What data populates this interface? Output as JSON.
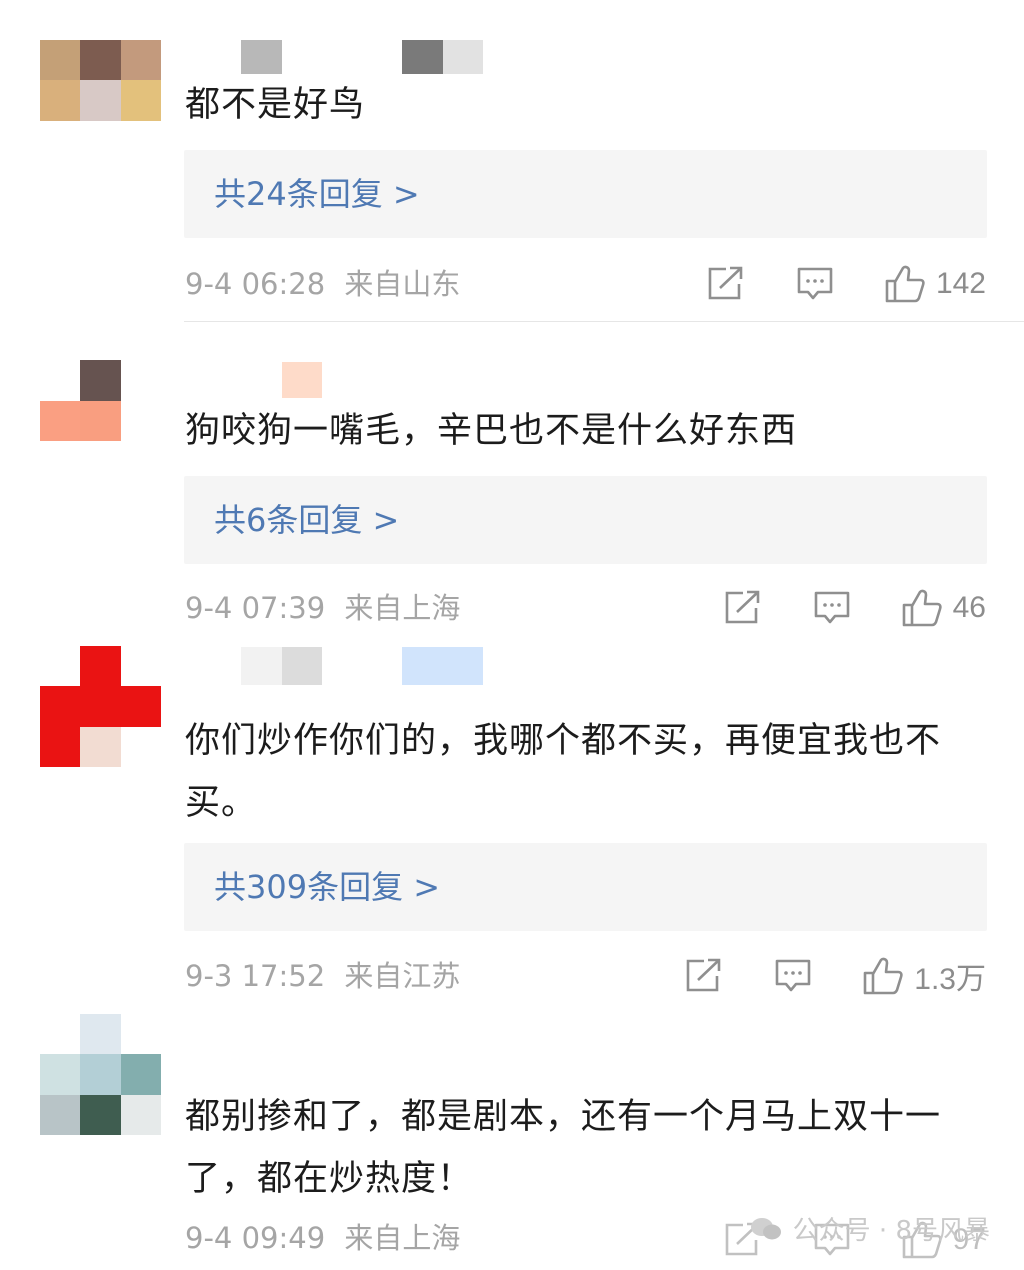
{
  "comments": [
    {
      "text": "都不是好鸟",
      "reply_label": "共24条回复 >",
      "date": "9-4 06:28",
      "location": "来自山东",
      "likes": "142"
    },
    {
      "text": "狗咬狗一嘴毛，辛巴也不是什么好东西",
      "reply_label": "共6条回复 >",
      "date": "9-4 07:39",
      "location": "来自上海",
      "likes": "46"
    },
    {
      "text": "你们炒作你们的，我哪个都不买，再便宜我也不买。",
      "reply_label": "共309条回复 >",
      "date": "9-3 17:52",
      "location": "来自江苏",
      "likes": "1.3万"
    },
    {
      "text": "都别掺和了，都是剧本，还有一个月马上双十一了，都在炒热度！",
      "reply_label": "",
      "date": "9-4 09:49",
      "location": "来自上海",
      "likes": "97"
    }
  ],
  "watermark": "公众号 · 8号风暴",
  "icons": {
    "share": "share-icon",
    "comment": "comment-icon",
    "like": "thumbs-up-icon"
  },
  "colors": {
    "reply_link": "#4f79b3",
    "meta_text": "#a5a5a5",
    "reply_bg": "#f5f5f5"
  }
}
